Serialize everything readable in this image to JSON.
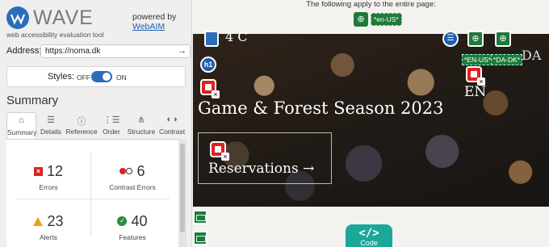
{
  "wave": {
    "logo_text": "WAVE",
    "tagline": "web accessibility evaluation tool",
    "powered_by": "powered by",
    "webaim": "WebAIM",
    "address_label": "Address:",
    "address_value": "https://noma.dk",
    "styles_label": "Styles:",
    "styles_off": "OFF",
    "styles_on": "ON",
    "summary_heading": "Summary",
    "tabs": [
      {
        "label": "Summary",
        "icon": "home-icon",
        "glyph": "⌂"
      },
      {
        "label": "Details",
        "icon": "details-list-icon",
        "glyph": "☰"
      },
      {
        "label": "Reference",
        "icon": "info-icon",
        "glyph": "ⓘ"
      },
      {
        "label": "Order",
        "icon": "order-icon",
        "glyph": "⋮☰"
      },
      {
        "label": "Structure",
        "icon": "structure-icon",
        "glyph": "⋔"
      },
      {
        "label": "Contrast",
        "icon": "contrast-icon",
        "glyph": "◐◑"
      }
    ],
    "stats": {
      "errors": {
        "value": "12",
        "label": "Errors"
      },
      "contrast": {
        "value": "6",
        "label": "Contrast Errors"
      },
      "alerts": {
        "value": "23",
        "label": "Alerts"
      },
      "features": {
        "value": "40",
        "label": "Features"
      }
    }
  },
  "page": {
    "applies_text": "The following apply to the entire page:",
    "page_lang_tag": "*en-US*",
    "hero_lang_en": "*EN-US*",
    "hero_lang_da": "*DA-DK*",
    "four_c": "4 C",
    "da_label": "DA",
    "en_label": "EN",
    "hero_title": "Game & Forest Season 2023",
    "reservations": "Reservations →",
    "code_glyph": "</>",
    "code_label": "Code"
  },
  "colors": {
    "wave_blue": "#2a6ebb",
    "error_red": "#dd2222",
    "feature_green": "#2e8b3e",
    "alert_orange": "#e8a317",
    "code_teal": "#1aa89a"
  }
}
